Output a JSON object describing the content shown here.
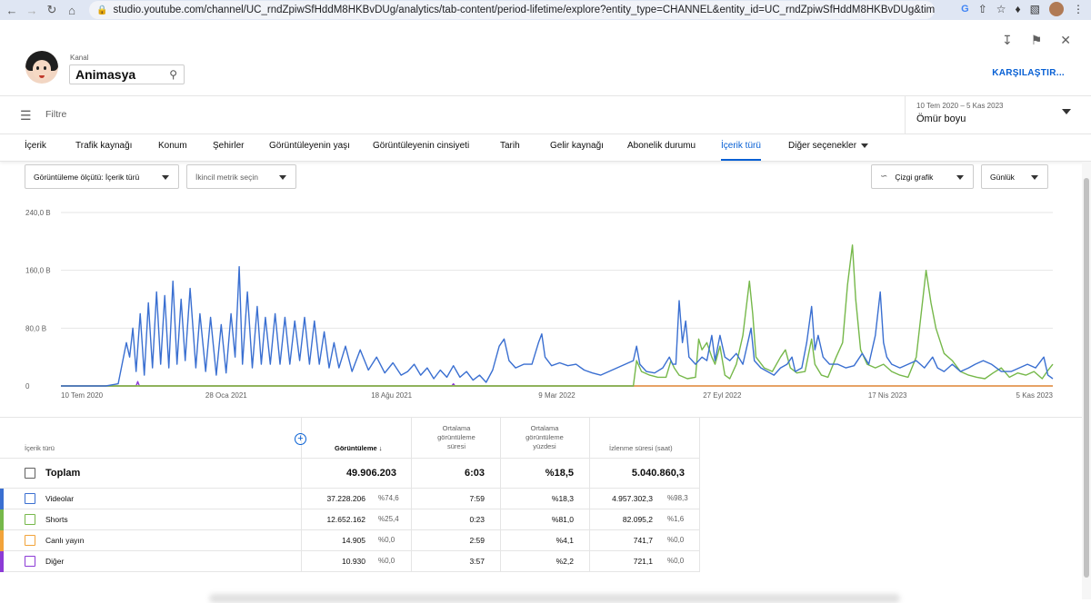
{
  "browser": {
    "url": "studio.youtube.com/channel/UC_rndZpiwSfHddM8HKBvDUg/analytics/tab-content/period-lifetime/explore?entity_type=CHANNEL&entity_id=UC_rndZpiwSfHddM8HKBvDUg&time_period=lifet..."
  },
  "header": {
    "kanal_label": "Kanal",
    "channel_name": "Animasya",
    "compare_button": "KARŞILAŞTIR..."
  },
  "filter": {
    "label": "Filtre",
    "period_range": "10 Tem 2020 – 5 Kas 2023",
    "period_name": "Ömür boyu"
  },
  "tabs": [
    {
      "label": "İçerik"
    },
    {
      "label": "Trafik kaynağı"
    },
    {
      "label": "Konum"
    },
    {
      "label": "Şehirler"
    },
    {
      "label": "Görüntüleyenin yaşı"
    },
    {
      "label": "Görüntüleyenin cinsiyeti"
    },
    {
      "label": "Tarih"
    },
    {
      "label": "Gelir kaynağı"
    },
    {
      "label": "Abonelik durumu"
    },
    {
      "label": "İçerik türü"
    },
    {
      "label": "Diğer seçenekler"
    }
  ],
  "controls": {
    "metric_select": "Görüntüleme ölçütü: İçerik türü",
    "secondary_metric": "İkincil metrik seçin",
    "chart_type": "Çizgi grafik",
    "granularity": "Günlük"
  },
  "chart_data": {
    "type": "line",
    "title": "",
    "xlabel": "",
    "ylabel": "",
    "ylim": [
      0,
      240
    ],
    "y_ticks": [
      "240,0 B",
      "160,0 B",
      "80,0 B",
      "0"
    ],
    "y_tick_values": [
      240,
      160,
      80,
      0
    ],
    "x_ticks": [
      "10 Tem 2020",
      "28 Oca 2021",
      "18 Ağu 2021",
      "9 Mar 2022",
      "27 Eyl 2022",
      "17 Nis 2023",
      "5 Kas 2023"
    ],
    "x_range_days": [
      0,
      1213
    ],
    "grid": true,
    "series": [
      {
        "name": "Videolar",
        "color": "#3a6fd1",
        "points": [
          [
            0,
            0
          ],
          [
            55,
            0
          ],
          [
            70,
            3
          ],
          [
            80,
            60
          ],
          [
            84,
            40
          ],
          [
            88,
            80
          ],
          [
            92,
            20
          ],
          [
            97,
            100
          ],
          [
            102,
            15
          ],
          [
            107,
            115
          ],
          [
            112,
            25
          ],
          [
            117,
            130
          ],
          [
            122,
            30
          ],
          [
            127,
            125
          ],
          [
            132,
            25
          ],
          [
            137,
            145
          ],
          [
            142,
            30
          ],
          [
            147,
            120
          ],
          [
            152,
            35
          ],
          [
            158,
            135
          ],
          [
            165,
            25
          ],
          [
            170,
            100
          ],
          [
            177,
            20
          ],
          [
            183,
            95
          ],
          [
            190,
            15
          ],
          [
            196,
            85
          ],
          [
            202,
            18
          ],
          [
            208,
            100
          ],
          [
            213,
            40
          ],
          [
            218,
            165
          ],
          [
            222,
            30
          ],
          [
            228,
            130
          ],
          [
            234,
            25
          ],
          [
            240,
            110
          ],
          [
            245,
            30
          ],
          [
            250,
            95
          ],
          [
            256,
            30
          ],
          [
            262,
            100
          ],
          [
            268,
            30
          ],
          [
            274,
            95
          ],
          [
            280,
            30
          ],
          [
            286,
            90
          ],
          [
            292,
            35
          ],
          [
            298,
            95
          ],
          [
            304,
            30
          ],
          [
            310,
            90
          ],
          [
            316,
            30
          ],
          [
            322,
            75
          ],
          [
            328,
            25
          ],
          [
            334,
            60
          ],
          [
            340,
            25
          ],
          [
            348,
            55
          ],
          [
            356,
            20
          ],
          [
            366,
            50
          ],
          [
            376,
            22
          ],
          [
            386,
            40
          ],
          [
            396,
            18
          ],
          [
            406,
            32
          ],
          [
            416,
            15
          ],
          [
            424,
            20
          ],
          [
            432,
            30
          ],
          [
            440,
            15
          ],
          [
            448,
            25
          ],
          [
            456,
            10
          ],
          [
            464,
            22
          ],
          [
            472,
            12
          ],
          [
            480,
            28
          ],
          [
            488,
            12
          ],
          [
            496,
            20
          ],
          [
            504,
            8
          ],
          [
            512,
            15
          ],
          [
            520,
            5
          ],
          [
            528,
            22
          ],
          [
            536,
            55
          ],
          [
            542,
            65
          ],
          [
            548,
            35
          ],
          [
            556,
            25
          ],
          [
            566,
            30
          ],
          [
            576,
            30
          ],
          [
            584,
            60
          ],
          [
            588,
            72
          ],
          [
            592,
            40
          ],
          [
            600,
            28
          ],
          [
            610,
            32
          ],
          [
            620,
            28
          ],
          [
            630,
            30
          ],
          [
            640,
            22
          ],
          [
            650,
            18
          ],
          [
            660,
            15
          ],
          [
            670,
            20
          ],
          [
            680,
            25
          ],
          [
            690,
            30
          ],
          [
            700,
            35
          ],
          [
            704,
            55
          ],
          [
            708,
            30
          ],
          [
            716,
            20
          ],
          [
            726,
            18
          ],
          [
            736,
            25
          ],
          [
            744,
            40
          ],
          [
            748,
            30
          ],
          [
            752,
            30
          ],
          [
            756,
            118
          ],
          [
            760,
            60
          ],
          [
            764,
            90
          ],
          [
            768,
            40
          ],
          [
            776,
            30
          ],
          [
            784,
            40
          ],
          [
            790,
            35
          ],
          [
            796,
            70
          ],
          [
            800,
            35
          ],
          [
            806,
            70
          ],
          [
            812,
            40
          ],
          [
            818,
            35
          ],
          [
            826,
            45
          ],
          [
            834,
            30
          ],
          [
            840,
            60
          ],
          [
            844,
            80
          ],
          [
            848,
            35
          ],
          [
            856,
            25
          ],
          [
            864,
            20
          ],
          [
            872,
            15
          ],
          [
            880,
            25
          ],
          [
            888,
            30
          ],
          [
            894,
            40
          ],
          [
            898,
            20
          ],
          [
            906,
            25
          ],
          [
            912,
            60
          ],
          [
            918,
            110
          ],
          [
            922,
            50
          ],
          [
            926,
            70
          ],
          [
            932,
            40
          ],
          [
            940,
            30
          ],
          [
            950,
            30
          ],
          [
            960,
            25
          ],
          [
            970,
            28
          ],
          [
            980,
            45
          ],
          [
            988,
            30
          ],
          [
            996,
            70
          ],
          [
            1002,
            130
          ],
          [
            1006,
            60
          ],
          [
            1010,
            40
          ],
          [
            1016,
            30
          ],
          [
            1026,
            25
          ],
          [
            1036,
            30
          ],
          [
            1046,
            35
          ],
          [
            1056,
            25
          ],
          [
            1066,
            40
          ],
          [
            1072,
            25
          ],
          [
            1080,
            20
          ],
          [
            1090,
            30
          ],
          [
            1100,
            20
          ],
          [
            1110,
            25
          ],
          [
            1118,
            30
          ],
          [
            1128,
            35
          ],
          [
            1138,
            30
          ],
          [
            1150,
            20
          ],
          [
            1162,
            20
          ],
          [
            1172,
            25
          ],
          [
            1182,
            30
          ],
          [
            1192,
            25
          ],
          [
            1202,
            40
          ],
          [
            1207,
            15
          ],
          [
            1213,
            10
          ]
        ]
      },
      {
        "name": "Shorts",
        "color": "#76b84a",
        "points": [
          [
            0,
            0
          ],
          [
            700,
            0
          ],
          [
            704,
            35
          ],
          [
            710,
            20
          ],
          [
            720,
            15
          ],
          [
            730,
            12
          ],
          [
            740,
            12
          ],
          [
            746,
            35
          ],
          [
            750,
            25
          ],
          [
            756,
            15
          ],
          [
            766,
            10
          ],
          [
            776,
            12
          ],
          [
            780,
            65
          ],
          [
            784,
            50
          ],
          [
            790,
            60
          ],
          [
            796,
            40
          ],
          [
            800,
            30
          ],
          [
            806,
            55
          ],
          [
            812,
            15
          ],
          [
            818,
            10
          ],
          [
            826,
            30
          ],
          [
            834,
            70
          ],
          [
            842,
            145
          ],
          [
            846,
            100
          ],
          [
            850,
            40
          ],
          [
            860,
            25
          ],
          [
            870,
            20
          ],
          [
            880,
            40
          ],
          [
            886,
            50
          ],
          [
            892,
            25
          ],
          [
            900,
            18
          ],
          [
            910,
            20
          ],
          [
            918,
            65
          ],
          [
            922,
            30
          ],
          [
            930,
            15
          ],
          [
            938,
            12
          ],
          [
            948,
            40
          ],
          [
            956,
            60
          ],
          [
            962,
            140
          ],
          [
            968,
            195
          ],
          [
            972,
            120
          ],
          [
            978,
            50
          ],
          [
            986,
            30
          ],
          [
            996,
            25
          ],
          [
            1006,
            30
          ],
          [
            1016,
            20
          ],
          [
            1026,
            15
          ],
          [
            1036,
            12
          ],
          [
            1046,
            40
          ],
          [
            1052,
            100
          ],
          [
            1058,
            160
          ],
          [
            1064,
            115
          ],
          [
            1070,
            80
          ],
          [
            1080,
            45
          ],
          [
            1090,
            35
          ],
          [
            1100,
            20
          ],
          [
            1110,
            15
          ],
          [
            1120,
            12
          ],
          [
            1130,
            10
          ],
          [
            1140,
            18
          ],
          [
            1150,
            25
          ],
          [
            1160,
            12
          ],
          [
            1170,
            18
          ],
          [
            1180,
            15
          ],
          [
            1190,
            20
          ],
          [
            1200,
            10
          ],
          [
            1206,
            20
          ],
          [
            1213,
            30
          ]
        ]
      },
      {
        "name": "Canlı yayın",
        "color": "#f2a33a",
        "points": [
          [
            0,
            0
          ],
          [
            1213,
            0
          ]
        ]
      },
      {
        "name": "Diğer",
        "color": "#8c3bd6",
        "points": [
          [
            0,
            0
          ],
          [
            92,
            0
          ],
          [
            94,
            6
          ],
          [
            96,
            0
          ],
          [
            478,
            0
          ],
          [
            480,
            3
          ],
          [
            482,
            0
          ],
          [
            1213,
            0
          ]
        ]
      }
    ]
  },
  "table": {
    "columns": {
      "content_type": "İçerik türü",
      "views": "Görüntüleme",
      "avg_duration": [
        "Ortalama",
        "görüntüleme",
        "süresi"
      ],
      "avg_percent": [
        "Ortalama",
        "görüntüleme",
        "yüzdesi"
      ],
      "watch_time": "İzlenme süresi (saat)"
    },
    "total": {
      "label": "Toplam",
      "views": "49.906.203",
      "avg_duration": "6:03",
      "avg_percent": "%18,5",
      "watch_time": "5.040.860,3"
    },
    "rows": [
      {
        "label": "Videolar",
        "color": "#3a6fd1",
        "views": "37.228.206",
        "views_pct": "%74,6",
        "avg_duration": "7:59",
        "avg_percent": "%18,3",
        "watch_time": "4.957.302,3",
        "watch_pct": "%98,3"
      },
      {
        "label": "Shorts",
        "color": "#76b84a",
        "views": "12.652.162",
        "views_pct": "%25,4",
        "avg_duration": "0:23",
        "avg_percent": "%81,0",
        "watch_time": "82.095,2",
        "watch_pct": "%1,6"
      },
      {
        "label": "Canlı yayın",
        "color": "#f2a33a",
        "views": "14.905",
        "views_pct": "%0,0",
        "avg_duration": "2:59",
        "avg_percent": "%4,1",
        "watch_time": "741,7",
        "watch_pct": "%0,0"
      },
      {
        "label": "Diğer",
        "color": "#8c3bd6",
        "views": "10.930",
        "views_pct": "%0,0",
        "avg_duration": "3:57",
        "avg_percent": "%2,2",
        "watch_time": "721,1",
        "watch_pct": "%0,0"
      }
    ]
  }
}
